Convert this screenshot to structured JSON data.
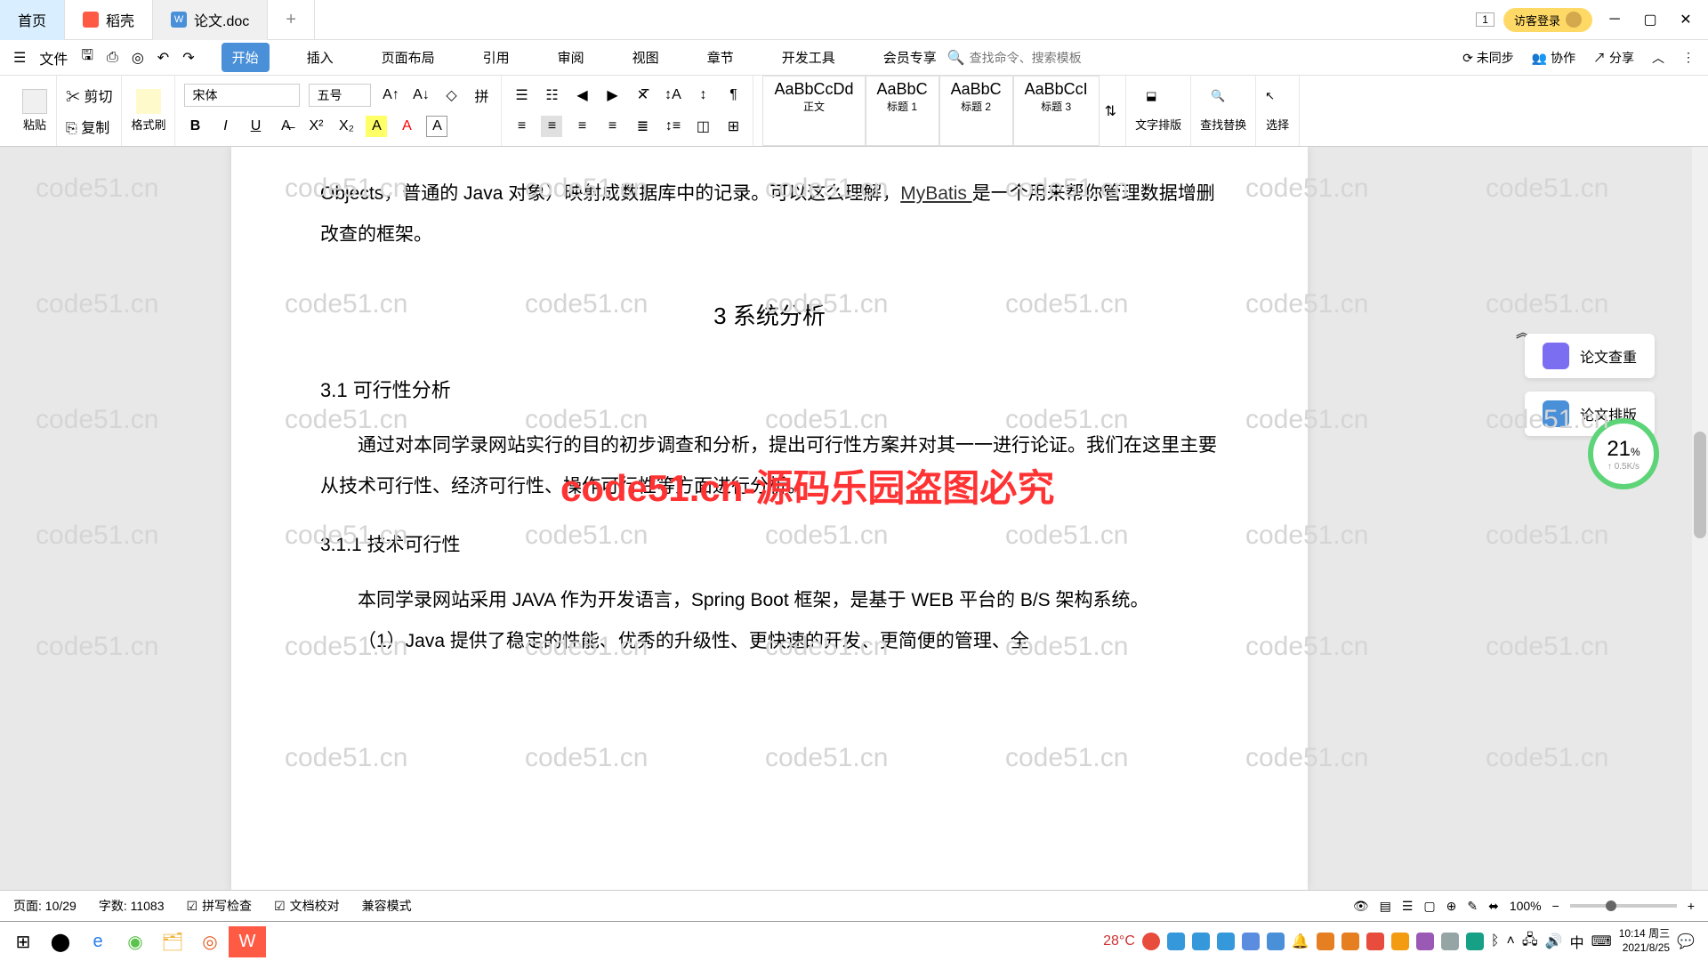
{
  "tabs": {
    "home": "首页",
    "dao": "稻壳",
    "doc": "论文.doc"
  },
  "titlebar": {
    "login": "访客登录",
    "index_badge": "1"
  },
  "menu": {
    "file": "文件",
    "start": "开始",
    "insert": "插入",
    "layout": "页面布局",
    "reference": "引用",
    "review": "审阅",
    "view": "视图",
    "chapter": "章节",
    "devtools": "开发工具",
    "vip": "会员专享",
    "search_placeholder": "查找命令、搜索模板",
    "unsync": "未同步",
    "collab": "协作",
    "share": "分享"
  },
  "toolbar": {
    "paste": "粘贴",
    "cut": "剪切",
    "copy": "复制",
    "format_painter": "格式刷",
    "font_name": "宋体",
    "font_size": "五号",
    "styles": {
      "s1_preview": "AaBbCcDd",
      "s1_label": "正文",
      "s2_preview": "AaBbC",
      "s2_label": "标题 1",
      "s3_preview": "AaBbC",
      "s3_label": "标题 2",
      "s4_preview": "AaBbCcI",
      "s4_label": "标题 3"
    },
    "text_layout": "文字排版",
    "find_replace": "查找替换",
    "select": "选择"
  },
  "document": {
    "p1a": "Objects，普通的 Java 对象）映射成数据库中的记录。可以这么理解，",
    "p1_link": "MyBatis ",
    "p1b": "是一个用来帮你管理数据增删改查的框架。",
    "h3": "3 系统分析",
    "h4": "3.1 可行性分析",
    "p2": "通过对本同学录网站实行的目的初步调查和分析，提出可行性方案并对其一一进行论证。我们在这里主要从技术可行性、经济可行性、操作可行性等方面进行分析。",
    "h5": "3.1.1 技术可行性",
    "p3": "本同学录网站采用 JAVA 作为开发语言，Spring Boot 框架，是基于 WEB 平台的 B/S 架构系统。",
    "p4": "（1）Java 提供了稳定的性能、优秀的升级性、更快速的开发、更简便的管理、全"
  },
  "overlay": {
    "red_text": "code51.cn-源码乐园盗图必究",
    "watermark": "code51.cn"
  },
  "right_panel": {
    "check": "论文查重",
    "typeset": "论文排版",
    "gauge_value": "21",
    "gauge_pct": "%",
    "gauge_speed": "↑ 0.5K/s"
  },
  "statusbar": {
    "page": "页面: 10/29",
    "words": "字数: 11083",
    "spellcheck": "拼写检查",
    "docproof": "文档校对",
    "compat": "兼容模式",
    "zoom": "100%"
  },
  "taskbar": {
    "temp": "28°C",
    "ime": "中",
    "time": "10:14 周三",
    "date": "2021/8/25"
  }
}
